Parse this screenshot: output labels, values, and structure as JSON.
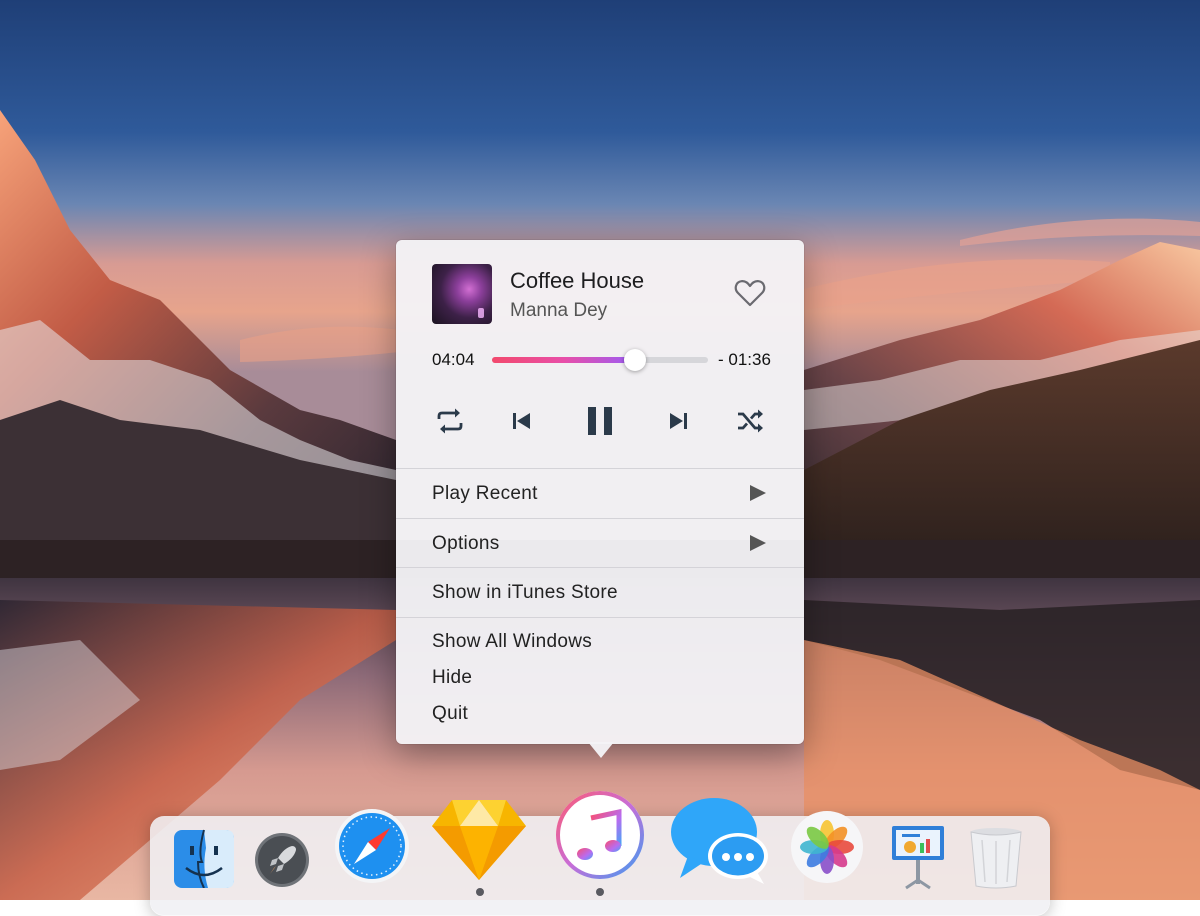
{
  "now_playing": {
    "title": "Coffee House",
    "artist": "Manna Dey",
    "elapsed": "04:04",
    "remaining": "- 01:36",
    "progress_fraction": 0.66,
    "progress_gradient": [
      "#f2496d",
      "#9b5cf5"
    ],
    "favorite": false
  },
  "controls": [
    "repeat-icon",
    "previous-track-icon",
    "pause-icon",
    "next-track-icon",
    "shuffle-icon"
  ],
  "menu": {
    "play_recent": "Play Recent",
    "options": "Options",
    "show_in_store": "Show in iTunes Store",
    "show_all_windows": "Show All Windows",
    "hide": "Hide",
    "quit": "Quit"
  },
  "dock": {
    "apps": [
      "finder-icon",
      "launchpad-icon",
      "safari-icon",
      "sketch-icon",
      "itunes-icon",
      "messages-icon",
      "photos-icon",
      "keynote-icon",
      "trash-icon"
    ],
    "running": [
      "sketch-icon",
      "itunes-icon"
    ]
  }
}
